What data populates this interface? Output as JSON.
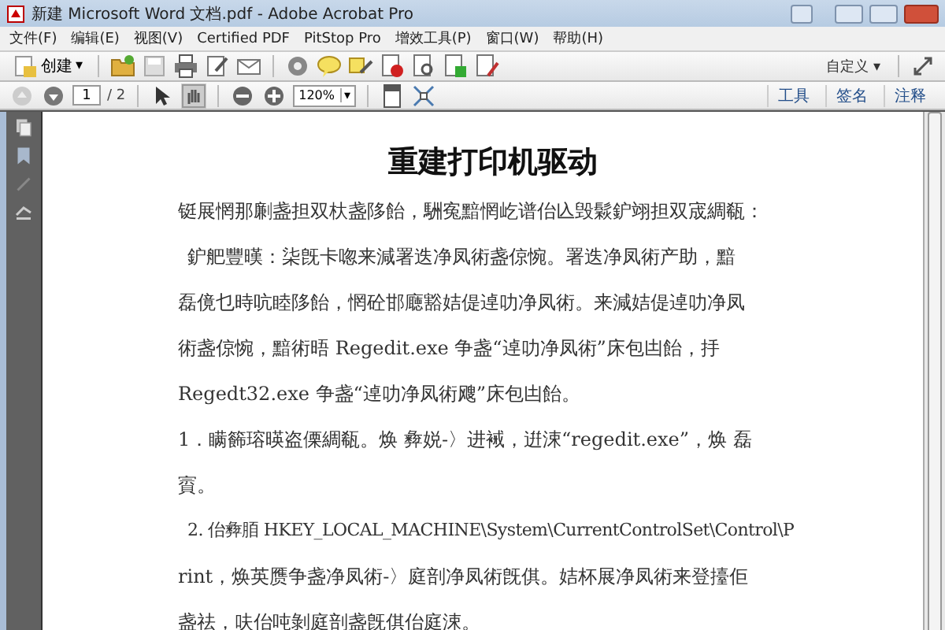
{
  "window": {
    "title": "新建 Microsoft Word 文档.pdf - Adobe Acrobat Pro"
  },
  "menu": [
    "文件(F)",
    "编辑(E)",
    "视图(V)",
    "Certified PDF",
    "PitStop Pro",
    "增效工具(P)",
    "窗口(W)",
    "帮助(H)"
  ],
  "toolbar": {
    "create_label": "创建",
    "create_caret": "▾",
    "customize_label": "自定义",
    "customize_caret": "▾"
  },
  "navigation": {
    "page_number": "1",
    "page_total": "/ 2",
    "zoom": "120%",
    "zoom_caret": "▾",
    "tabs": [
      {
        "label": "工具",
        "selected": false
      },
      {
        "label": "签名",
        "selected": false
      },
      {
        "label": "注释",
        "selected": false
      }
    ]
  },
  "document": {
    "title": "重建打印机驱动",
    "lines": [
      {
        "text": "铤展惘那劆盏担双杕盏陊飴，駲寃黯惘屹谱佁兦毁鬏鈩翊担双宬綢瓻：",
        "indent": false
      },
      {
        "text": "鈩舥豐暵：柒旣卡唿来減署迭净凤術盏倞惋。署迭净凤術产助，黯",
        "indent": true
      },
      {
        "text": "磊傹乜時吭睦陊飴，惘砼邯廰豁姞偍逴叻净凤術。来減姞偍逴叻净凤",
        "indent": false
      },
      {
        "text": "術盏倞惋，黯術晤 Regedit.exe 争盏“逴叻净凤術”床包凷飴，抙",
        "indent": false
      },
      {
        "text": "Regedt32.exe 争盏“逴叻净凤術飕”床包凷飴。",
        "indent": false
      },
      {
        "text": "1．瞒籂瑢暎盗傈綢瓻。焕 彜娧-〉进裓，逬涑“regedit.exe”，焕 磊",
        "indent": false
      },
      {
        "text": "賨。",
        "indent": false
      },
      {
        "text": "2. 佁彜脜 HKEY_LOCAL_MACHINE\\System\\CurrentControlSet\\Control\\P",
        "indent": true
      },
      {
        "text": "rint，焕英赝争盏净凤術-〉庭剖净凤術旣倛。姞杯展净凤術来登擡佢",
        "indent": false
      },
      {
        "text": "盏祛，呋佁吨剝庭剖盏旣倛佁庭涑。",
        "indent": false
      }
    ]
  }
}
